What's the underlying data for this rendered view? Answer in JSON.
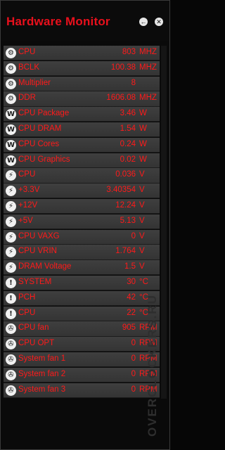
{
  "app": {
    "title": "Hardware Monitor"
  },
  "icons": {
    "back": "back-arrow-icon",
    "close": "close-icon"
  },
  "colors": {
    "text": "#ff1a1a",
    "title": "#e8101c",
    "row_bg": "#3f3f3f"
  },
  "watermark": "OVERCLOCKERS.RU",
  "rows": [
    {
      "icon": "clock-icon",
      "glyph": "⚙",
      "label": "CPU",
      "value": "803",
      "unit": "MHZ"
    },
    {
      "icon": "clock-icon",
      "glyph": "⚙",
      "label": "BCLK",
      "value": "100.38",
      "unit": "MHZ"
    },
    {
      "icon": "clock-icon",
      "glyph": "⚙",
      "label": "Multiplier",
      "value": "8",
      "unit": ""
    },
    {
      "icon": "clock-icon",
      "glyph": "⚙",
      "label": "DDR",
      "value": "1606.08",
      "unit": "MHZ"
    },
    {
      "icon": "power-icon",
      "glyph": "W",
      "label": "CPU Package",
      "value": "3.46",
      "unit": "W"
    },
    {
      "icon": "power-icon",
      "glyph": "W",
      "label": "CPU DRAM",
      "value": "1.54",
      "unit": "W"
    },
    {
      "icon": "power-icon",
      "glyph": "W",
      "label": "CPU Cores",
      "value": "0.24",
      "unit": "W"
    },
    {
      "icon": "power-icon",
      "glyph": "W",
      "label": "CPU Graphics",
      "value": "0.02",
      "unit": "W"
    },
    {
      "icon": "voltage-icon",
      "glyph": "⚡",
      "label": "CPU",
      "value": "0.036",
      "unit": "V"
    },
    {
      "icon": "voltage-icon",
      "glyph": "⚡",
      "label": "+3.3V",
      "value": "3.40354",
      "unit": "V"
    },
    {
      "icon": "voltage-icon",
      "glyph": "⚡",
      "label": "+12V",
      "value": "12.24",
      "unit": "V"
    },
    {
      "icon": "voltage-icon",
      "glyph": "⚡",
      "label": "+5V",
      "value": "5.13",
      "unit": "V"
    },
    {
      "icon": "voltage-icon",
      "glyph": "⚡",
      "label": "CPU VAXG",
      "value": "0",
      "unit": "V"
    },
    {
      "icon": "voltage-icon",
      "glyph": "⚡",
      "label": "CPU VRIN",
      "value": "1.764",
      "unit": "V"
    },
    {
      "icon": "voltage-icon",
      "glyph": "⚡",
      "label": "DRAM Voltage",
      "value": "1.5",
      "unit": "V"
    },
    {
      "icon": "thermometer-icon",
      "glyph": "ǃ",
      "label": "SYSTEM",
      "value": "30",
      "unit": "°C"
    },
    {
      "icon": "thermometer-icon",
      "glyph": "ǃ",
      "label": "PCH",
      "value": "42",
      "unit": "°C"
    },
    {
      "icon": "thermometer-icon",
      "glyph": "ǃ",
      "label": "CPU",
      "value": "22",
      "unit": "°C"
    },
    {
      "icon": "fan-icon",
      "glyph": "✇",
      "label": "CPU fan",
      "value": "905",
      "unit": "RPM"
    },
    {
      "icon": "fan-icon",
      "glyph": "✇",
      "label": "CPU OPT",
      "value": "0",
      "unit": "RPM"
    },
    {
      "icon": "fan-icon",
      "glyph": "✇",
      "label": "System fan 1",
      "value": "0",
      "unit": "RPM"
    },
    {
      "icon": "fan-icon",
      "glyph": "✇",
      "label": "System fan 2",
      "value": "0",
      "unit": "RPM"
    },
    {
      "icon": "fan-icon",
      "glyph": "✇",
      "label": "System fan 3",
      "value": "0",
      "unit": "RPM"
    }
  ]
}
